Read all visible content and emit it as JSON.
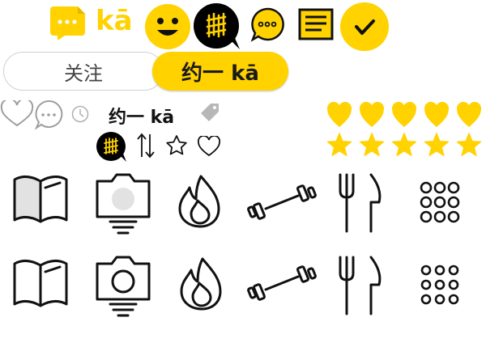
{
  "brand": {
    "logo_text": "kā"
  },
  "buttons": {
    "follow_label": "关注",
    "date_label": "约一 kā"
  },
  "label": {
    "text": "约一 kā"
  },
  "ratings": {
    "hearts": {
      "filled": 5,
      "total": 5
    },
    "stars": {
      "filled": 5,
      "total": 5
    }
  },
  "colors": {
    "accent": "#ffd200",
    "ink": "#111111",
    "gray": "#9e9e9e",
    "light_gray": "#e0e0e0"
  },
  "icons": {
    "row1": [
      "chat-bubble-icon",
      "smiley-icon",
      "grill-badge-icon",
      "speech-bubble-icon",
      "notes-icon",
      "check-circle-icon"
    ],
    "small": [
      "heart-outline-icon",
      "comment-icon",
      "clock-icon",
      "tag-icon",
      "grill-badge-small-icon",
      "sort-arrows-icon",
      "star-outline-icon",
      "heart-outline-small-icon"
    ],
    "large_filled": [
      "book-filled-icon",
      "camera-filled-icon",
      "flame-icon",
      "dumbbell-icon",
      "fork-knife-icon",
      "dots-grid-icon"
    ],
    "large_outline": [
      "book-outline-icon",
      "camera-outline-icon",
      "flame-outline-icon",
      "dumbbell-outline-icon",
      "fork-knife-outline-icon",
      "dots-grid-outline-icon"
    ]
  }
}
